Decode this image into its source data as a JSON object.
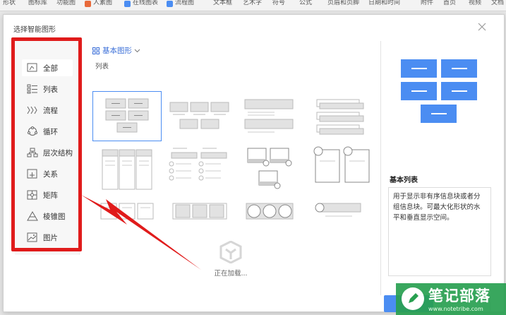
{
  "ribbon": {
    "items": [
      "形状",
      "图标库",
      "功能图",
      "人素图",
      "在线图表",
      "流程图",
      "文本框",
      "艺术字",
      "符号",
      "公式",
      "页眉和页脚",
      "日期和时间",
      "附件",
      "首页",
      "视频",
      "文档"
    ]
  },
  "dialog": {
    "title": "选择智能图形",
    "close_icon": "close-icon"
  },
  "categories": [
    {
      "label": "全部",
      "icon": "all-icon",
      "active": true
    },
    {
      "label": "列表",
      "icon": "list-icon"
    },
    {
      "label": "流程",
      "icon": "process-icon"
    },
    {
      "label": "循环",
      "icon": "cycle-icon"
    },
    {
      "label": "层次结构",
      "icon": "hierarchy-icon"
    },
    {
      "label": "关系",
      "icon": "relationship-icon"
    },
    {
      "label": "矩阵",
      "icon": "matrix-icon"
    },
    {
      "label": "棱锥图",
      "icon": "pyramid-icon"
    },
    {
      "label": "图片",
      "icon": "picture-icon"
    }
  ],
  "main": {
    "filter_label": "基本图形",
    "section_label": "列表",
    "loading_text": "正在加载..."
  },
  "preview": {
    "name": "基本列表",
    "description": "用于显示非有序信息块或者分组信息块。可最大化形状的水平和垂直显示空间。"
  },
  "watermark": {
    "title": "笔记部落",
    "url": "www.notetribe.com"
  },
  "colors": {
    "accent": "#4b8df2",
    "annotation": "#e01b1b"
  }
}
